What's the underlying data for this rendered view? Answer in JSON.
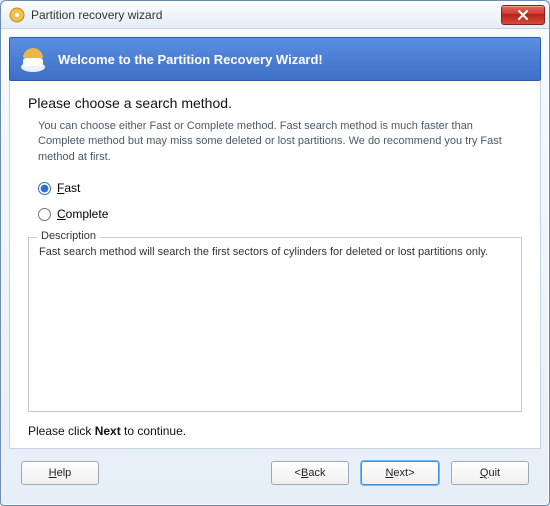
{
  "window": {
    "title": "Partition recovery wizard"
  },
  "banner": {
    "title": "Welcome to the Partition Recovery Wizard!"
  },
  "main": {
    "heading": "Please choose a search method.",
    "subtext": "You can choose either Fast or Complete method. Fast search method is much faster than Complete method but may miss some deleted or lost partitions. We do recommend you try Fast method at first.",
    "options": {
      "fast": "Fast",
      "complete": "Complete",
      "selected": "fast"
    },
    "description": {
      "legend": "Description",
      "text": "Fast search method will search the first sectors of cylinders for deleted or lost partitions only."
    },
    "continue_prefix": "Please click ",
    "continue_bold": "Next",
    "continue_suffix": " to continue."
  },
  "buttons": {
    "help": "Help",
    "back": "<Back",
    "next": "Next>",
    "quit": "Quit"
  }
}
